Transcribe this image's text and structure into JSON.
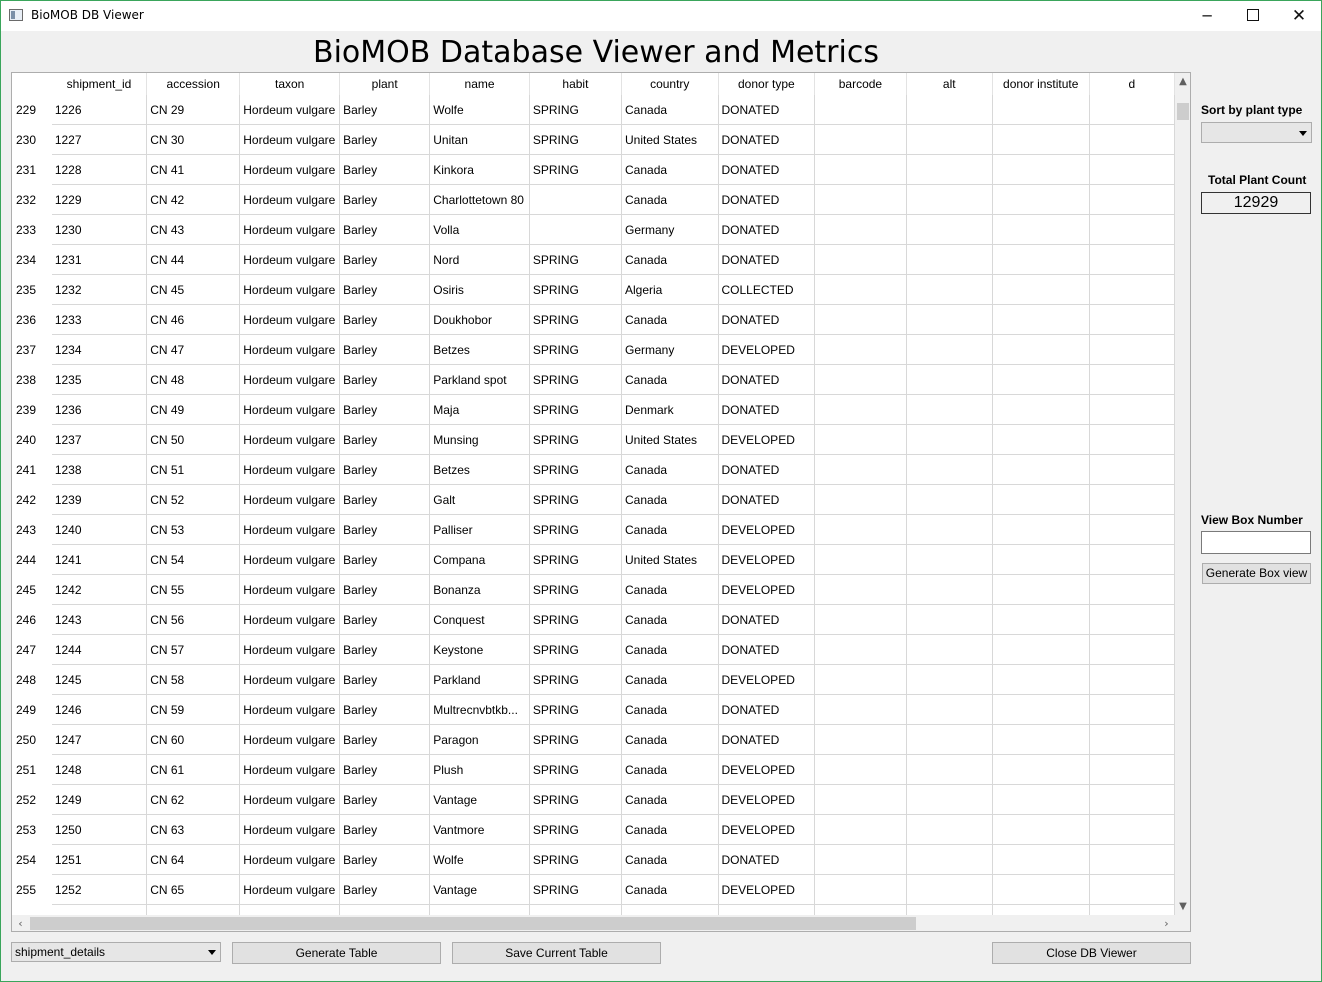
{
  "window": {
    "title": "BioMOB DB Viewer",
    "minimize": "─",
    "close": "✕"
  },
  "header": {
    "title": "BioMOB Database Viewer and Metrics"
  },
  "table": {
    "columns": [
      "shipment_id",
      "accession",
      "taxon",
      "plant",
      "name",
      "habit",
      "country",
      "donor type",
      "barcode",
      "alt",
      "donor institute",
      "d"
    ],
    "rows": [
      {
        "n": "229",
        "c": [
          "1226",
          "CN 29",
          "Hordeum vulgare",
          "Barley",
          "Wolfe",
          "SPRING",
          "Canada",
          "DONATED",
          "",
          "",
          "",
          ""
        ]
      },
      {
        "n": "230",
        "c": [
          "1227",
          "CN 30",
          "Hordeum vulgare",
          "Barley",
          "Unitan",
          "SPRING",
          "United States",
          "DONATED",
          "",
          "",
          "",
          ""
        ]
      },
      {
        "n": "231",
        "c": [
          "1228",
          "CN 41",
          "Hordeum vulgare",
          "Barley",
          "Kinkora",
          "SPRING",
          "Canada",
          "DONATED",
          "",
          "",
          "",
          ""
        ]
      },
      {
        "n": "232",
        "c": [
          "1229",
          "CN 42",
          "Hordeum vulgare",
          "Barley",
          "Charlottetown 80",
          "",
          "Canada",
          "DONATED",
          "",
          "",
          "",
          ""
        ]
      },
      {
        "n": "233",
        "c": [
          "1230",
          "CN 43",
          "Hordeum vulgare",
          "Barley",
          "Volla",
          "",
          "Germany",
          "DONATED",
          "",
          "",
          "",
          ""
        ]
      },
      {
        "n": "234",
        "c": [
          "1231",
          "CN 44",
          "Hordeum vulgare",
          "Barley",
          "Nord",
          "SPRING",
          "Canada",
          "DONATED",
          "",
          "",
          "",
          ""
        ]
      },
      {
        "n": "235",
        "c": [
          "1232",
          "CN 45",
          "Hordeum vulgare",
          "Barley",
          "Osiris",
          "SPRING",
          "Algeria",
          "COLLECTED",
          "",
          "",
          "",
          ""
        ]
      },
      {
        "n": "236",
        "c": [
          "1233",
          "CN 46",
          "Hordeum vulgare",
          "Barley",
          "Doukhobor",
          "SPRING",
          "Canada",
          "DONATED",
          "",
          "",
          "",
          ""
        ]
      },
      {
        "n": "237",
        "c": [
          "1234",
          "CN 47",
          "Hordeum vulgare",
          "Barley",
          "Betzes",
          "SPRING",
          "Germany",
          "DEVELOPED",
          "",
          "",
          "",
          ""
        ]
      },
      {
        "n": "238",
        "c": [
          "1235",
          "CN 48",
          "Hordeum vulgare",
          "Barley",
          "Parkland spot",
          "SPRING",
          "Canada",
          "DONATED",
          "",
          "",
          "",
          ""
        ]
      },
      {
        "n": "239",
        "c": [
          "1236",
          "CN 49",
          "Hordeum vulgare",
          "Barley",
          "Maja",
          "SPRING",
          "Denmark",
          "DONATED",
          "",
          "",
          "",
          ""
        ]
      },
      {
        "n": "240",
        "c": [
          "1237",
          "CN 50",
          "Hordeum vulgare",
          "Barley",
          "Munsing",
          "SPRING",
          "United States",
          "DEVELOPED",
          "",
          "",
          "",
          ""
        ]
      },
      {
        "n": "241",
        "c": [
          "1238",
          "CN 51",
          "Hordeum vulgare",
          "Barley",
          "Betzes",
          "SPRING",
          "Canada",
          "DONATED",
          "",
          "",
          "",
          ""
        ]
      },
      {
        "n": "242",
        "c": [
          "1239",
          "CN 52",
          "Hordeum vulgare",
          "Barley",
          "Galt",
          "SPRING",
          "Canada",
          "DONATED",
          "",
          "",
          "",
          ""
        ]
      },
      {
        "n": "243",
        "c": [
          "1240",
          "CN 53",
          "Hordeum vulgare",
          "Barley",
          "Palliser",
          "SPRING",
          "Canada",
          "DEVELOPED",
          "",
          "",
          "",
          ""
        ]
      },
      {
        "n": "244",
        "c": [
          "1241",
          "CN 54",
          "Hordeum vulgare",
          "Barley",
          "Compana",
          "SPRING",
          "United States",
          "DEVELOPED",
          "",
          "",
          "",
          ""
        ]
      },
      {
        "n": "245",
        "c": [
          "1242",
          "CN 55",
          "Hordeum vulgare",
          "Barley",
          "Bonanza",
          "SPRING",
          "Canada",
          "DEVELOPED",
          "",
          "",
          "",
          ""
        ]
      },
      {
        "n": "246",
        "c": [
          "1243",
          "CN 56",
          "Hordeum vulgare",
          "Barley",
          "Conquest",
          "SPRING",
          "Canada",
          "DONATED",
          "",
          "",
          "",
          ""
        ]
      },
      {
        "n": "247",
        "c": [
          "1244",
          "CN 57",
          "Hordeum vulgare",
          "Barley",
          "Keystone",
          "SPRING",
          "Canada",
          "DONATED",
          "",
          "",
          "",
          ""
        ]
      },
      {
        "n": "248",
        "c": [
          "1245",
          "CN 58",
          "Hordeum vulgare",
          "Barley",
          "Parkland",
          "SPRING",
          "Canada",
          "DEVELOPED",
          "",
          "",
          "",
          ""
        ]
      },
      {
        "n": "249",
        "c": [
          "1246",
          "CN 59",
          "Hordeum vulgare",
          "Barley",
          "Multrecnvbtkb...",
          "SPRING",
          "Canada",
          "DONATED",
          "",
          "",
          "",
          ""
        ]
      },
      {
        "n": "250",
        "c": [
          "1247",
          "CN 60",
          "Hordeum vulgare",
          "Barley",
          "Paragon",
          "SPRING",
          "Canada",
          "DONATED",
          "",
          "",
          "",
          ""
        ]
      },
      {
        "n": "251",
        "c": [
          "1248",
          "CN 61",
          "Hordeum vulgare",
          "Barley",
          "Plush",
          "SPRING",
          "Canada",
          "DEVELOPED",
          "",
          "",
          "",
          ""
        ]
      },
      {
        "n": "252",
        "c": [
          "1249",
          "CN 62",
          "Hordeum vulgare",
          "Barley",
          "Vantage",
          "SPRING",
          "Canada",
          "DEVELOPED",
          "",
          "",
          "",
          ""
        ]
      },
      {
        "n": "253",
        "c": [
          "1250",
          "CN 63",
          "Hordeum vulgare",
          "Barley",
          "Vantmore",
          "SPRING",
          "Canada",
          "DEVELOPED",
          "",
          "",
          "",
          ""
        ]
      },
      {
        "n": "254",
        "c": [
          "1251",
          "CN 64",
          "Hordeum vulgare",
          "Barley",
          "Wolfe",
          "SPRING",
          "Canada",
          "DONATED",
          "",
          "",
          "",
          ""
        ]
      },
      {
        "n": "255",
        "c": [
          "1252",
          "CN 65",
          "Hordeum vulgare",
          "Barley",
          "Vantage",
          "SPRING",
          "Canada",
          "DEVELOPED",
          "",
          "",
          "",
          ""
        ]
      },
      {
        "n": "",
        "c": [
          "",
          "",
          "",
          "",
          "",
          "",
          "",
          "",
          "",
          "",
          "",
          ""
        ]
      }
    ]
  },
  "sidebar": {
    "sort_label": "Sort by plant type",
    "sort_value": "",
    "count_label": "Total Plant Count",
    "count_value": "12929",
    "box_label": "View Box Number",
    "box_value": "",
    "generate_box_label": "Generate Box view"
  },
  "footer": {
    "table_select": "shipment_details",
    "generate_table_label": "Generate Table",
    "save_table_label": "Save Current Table",
    "close_label": "Close DB Viewer"
  },
  "icons": {
    "scroll_up": "up-arrow-icon",
    "scroll_down": "down-arrow-icon",
    "scroll_left": "left-arrow-icon",
    "scroll_right": "right-arrow-icon"
  }
}
